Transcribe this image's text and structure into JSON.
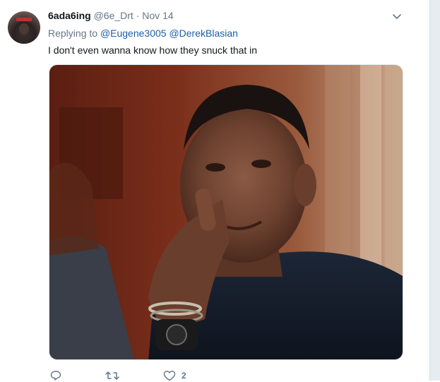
{
  "tweet": {
    "fullname": "6ada6ing",
    "username": "@6e_Drt",
    "separator": "·",
    "timestamp": "Nov 14",
    "replying_prefix": "Replying to",
    "mentions": [
      "@Eugene3005",
      "@DerekBlasian"
    ],
    "text": "I don't even wanna know how they snuck that in",
    "actions": {
      "reply_icon": "reply-icon",
      "retweet_icon": "retweet-icon",
      "like_icon": "heart-icon",
      "like_count": "2"
    },
    "caret_icon": "chevron-down-icon"
  },
  "colors": {
    "text_primary": "#14171a",
    "text_secondary": "#657786",
    "link": "#1b5fa6",
    "border": "#e1e8ed"
  }
}
